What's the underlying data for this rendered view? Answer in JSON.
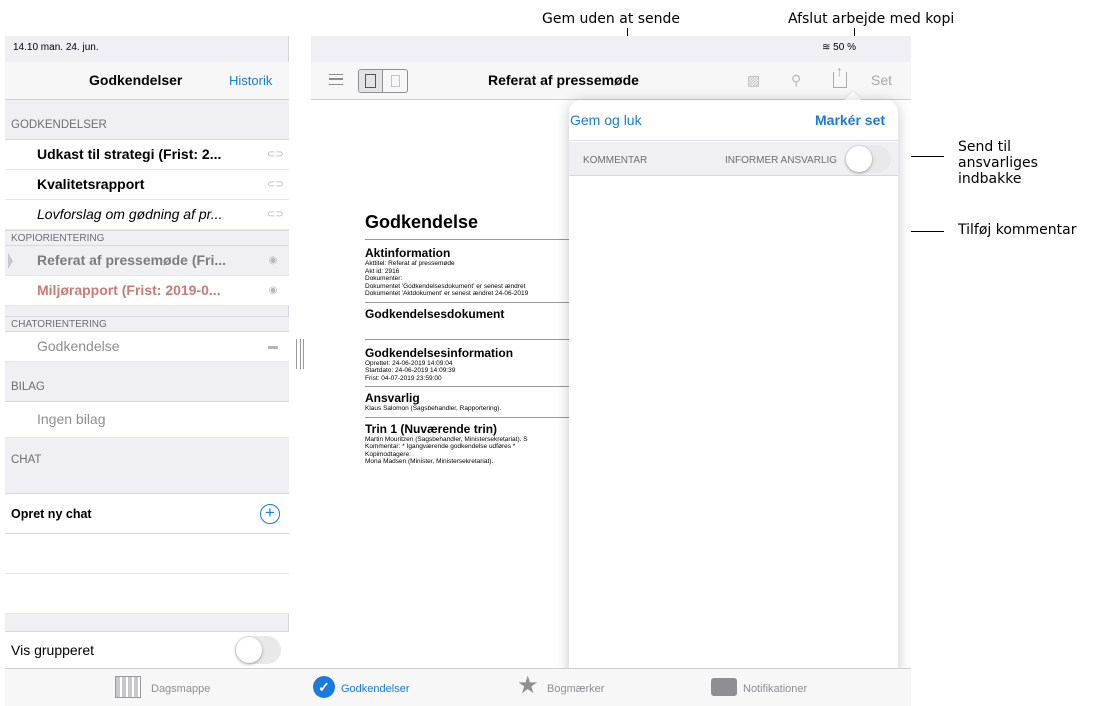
{
  "annotations": {
    "save_no_send": "Gem uden at sende",
    "finish_with_copy": "Afslut arbejde med kopi",
    "send_to_inbox": "Send til ansvarliges indbakke",
    "add_comment": "Tilføj kommentar"
  },
  "status": {
    "time": "14.10  man. 24. jun.",
    "battery": "50 %"
  },
  "sidebar": {
    "title": "Godkendelser",
    "history_link": "Historik",
    "sections": {
      "approvals": "GODKENDELSER",
      "copy_orientation": "KOPIORIENTERING",
      "chat_orientation": "CHATORIENTERING",
      "attachments": "BILAG",
      "chat": "CHAT"
    },
    "items": {
      "approval_1": "Udkast til strategi (Frist: 2...",
      "approval_2": "Kvalitetsrapport",
      "approval_3": "Lovforslag om gødning af pr...",
      "copy_1": "Referat af pressemøde (Fri...",
      "copy_2": "Miljørapport (Frist: 2019-0...",
      "chat_orient_1": "Godkendelse",
      "attachments_empty": "Ingen bilag",
      "new_chat": "Opret ny chat"
    },
    "group_toggle_label": "Vis grupperet",
    "group_toggle_on": false
  },
  "document": {
    "nav_title": "Referat af pressemøde",
    "set_button": "Set",
    "heading": "Godkendelse",
    "sections": [
      {
        "title": "Aktinformation",
        "lines": [
          "Akttitel: Referat af pressemøde",
          "Akt id: 2916",
          "Dokumenter:",
          "Dokumentet 'Godkendelsesdokument' er senest ændret",
          "Dokumentet 'Aktdokument' er senest ændret 24-06-2019"
        ]
      },
      {
        "title": "Godkendelsesdokument",
        "lines": []
      },
      {
        "title": "Godkendelsesinformation",
        "lines": [
          "Oprettet: 24-06-2019 14:09:04",
          "Startdato: 24-06-2019 14:09:39",
          "Frist: 04-07-2019 23:59:00"
        ]
      },
      {
        "title": "Ansvarlig",
        "lines": [
          "Klaus Salomon (Sagsbehandler, Rapportering)."
        ]
      },
      {
        "title": "Trin 1 (Nuværende trin)",
        "lines": [
          "Martin Mouritzen (Sagsbehandler, Ministersekretariat). S",
          "Kommentar: * Igangværende godkendelse udføres *",
          "Kopimodtagere:",
          "Mona Madsen (Minister, Ministersekretariat)."
        ]
      }
    ]
  },
  "popover": {
    "save_close": "Gem og luk",
    "mark_seen": "Markér set",
    "comment_label": "KOMMENTAR",
    "inform_label": "INFORMER ANSVARLIG",
    "inform_on": false
  },
  "tabbar": {
    "tabs": [
      "Dagsmappe",
      "Godkendelser",
      "Bogmærker",
      "Notifikationer"
    ],
    "active_color": "#1a7adf"
  }
}
